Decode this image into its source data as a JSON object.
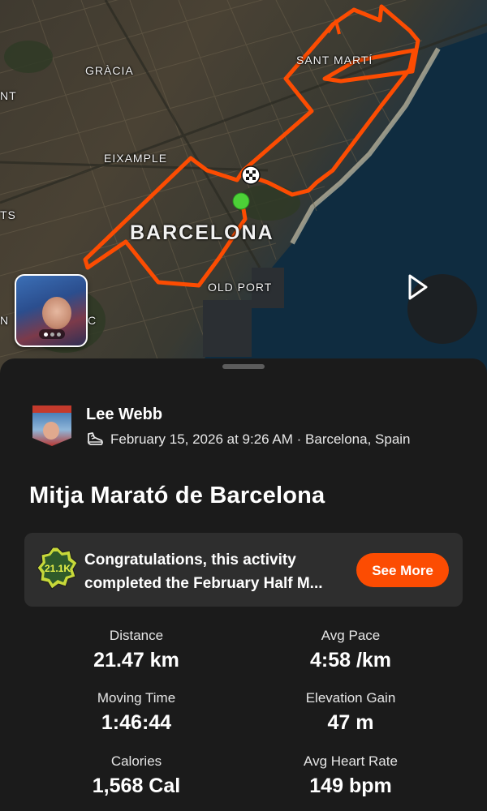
{
  "map": {
    "labels": {
      "gracia": "GRÀCIA",
      "sant_marti": "SANT MARTÍ",
      "eixample": "EIXAMPLE",
      "barcelona": "BARCELONA",
      "old_port": "OLD PORT",
      "edge_nt": "NT",
      "edge_ts": "TS",
      "edge_c": "C",
      "edge_n": "N"
    },
    "route_color": "#fc4c02",
    "start_marker_color": "#4cd137",
    "photo_count_indicator": 3
  },
  "icons": {
    "play": "play-icon",
    "finish_flag": "checkered-flag-icon",
    "shoe": "running-shoe-icon",
    "badge": "challenge-badge-icon"
  },
  "athlete": {
    "name": "Lee Webb",
    "meta": "February 15, 2026 at 9:26 AM · Barcelona, Spain"
  },
  "activity": {
    "title": "Mitja Marató de Barcelona"
  },
  "challenge": {
    "badge_text": "21.1K",
    "line1": "Congratulations, this activity",
    "line2": "completed the February Half M...",
    "button_label": "See More",
    "accent": "#fc4c02"
  },
  "stats": [
    {
      "label": "Distance",
      "value": "21.47 km"
    },
    {
      "label": "Avg Pace",
      "value": "4:58 /km"
    },
    {
      "label": "Moving Time",
      "value": "1:46:44"
    },
    {
      "label": "Elevation Gain",
      "value": "47 m"
    },
    {
      "label": "Calories",
      "value": "1,568 Cal"
    },
    {
      "label": "Avg Heart Rate",
      "value": "149 bpm"
    }
  ]
}
